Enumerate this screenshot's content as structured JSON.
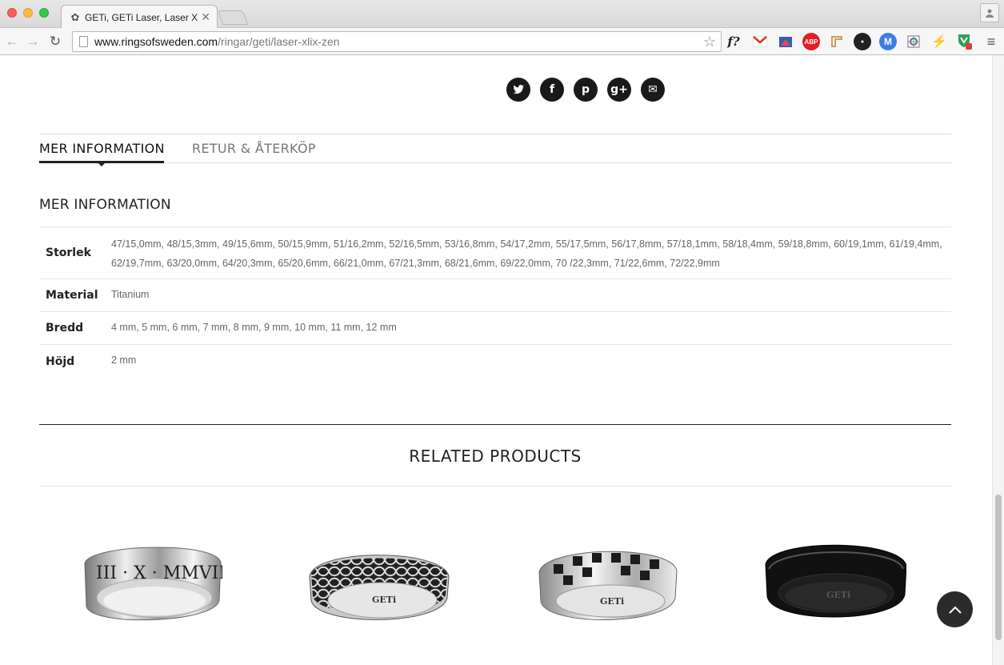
{
  "browser": {
    "tab_title": "GETi, GETi Laser, Laser XL",
    "tab_close": "✕",
    "url_host": "www.ringsofsweden.com",
    "url_path": "/ringar/geti/laser-xlix-zen",
    "ext_font": "f?",
    "ext_abp": "ABP",
    "ext_m": "M",
    "ext_badge": "1"
  },
  "social": {
    "twitter": "t",
    "facebook": "f",
    "pinterest": "p",
    "googleplus": "g+",
    "email": "✉"
  },
  "tabs": {
    "info": "MER INFORMATION",
    "returns": "RETUR & ÅTERKÖP"
  },
  "info": {
    "title": "MER INFORMATION",
    "rows": [
      {
        "label": "Storlek",
        "value": "47/15,0mm, 48/15,3mm, 49/15,6mm, 50/15,9mm, 51/16,2mm, 52/16,5mm, 53/16,8mm, 54/17,2mm, 55/17,5mm, 56/17,8mm, 57/18,1mm, 58/18,4mm, 59/18,8mm, 60/19,1mm, 61/19,4mm, 62/19,7mm, 63/20,0mm, 64/20,3mm, 65/20,6mm, 66/21,0mm, 67/21,3mm, 68/21,6mm, 69/22,0mm, 70 /22,3mm, 71/22,6mm, 72/22,9mm"
      },
      {
        "label": "Material",
        "value": "Titanium"
      },
      {
        "label": "Bredd",
        "value": "4 mm, 5 mm, 6 mm, 7 mm, 8 mm, 9 mm, 10 mm, 11 mm, 12 mm"
      },
      {
        "label": "Höjd",
        "value": "2 mm"
      }
    ]
  },
  "related": {
    "title": "RELATED PRODUCTS",
    "ring1_text": "III · X · MMVII",
    "brand": "GETi"
  }
}
